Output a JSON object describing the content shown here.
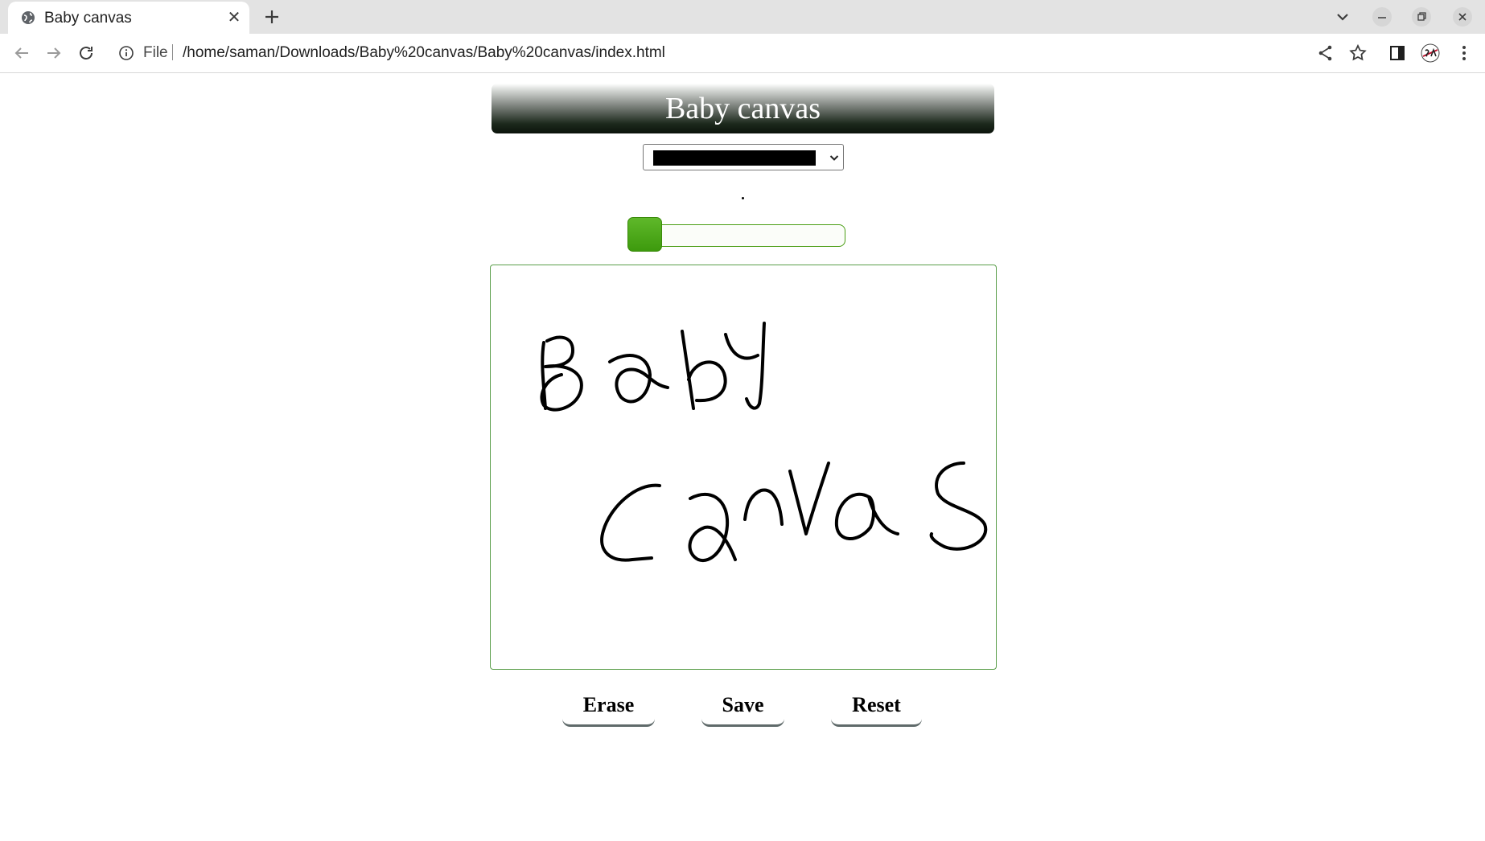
{
  "browser": {
    "tab_title": "Baby canvas",
    "omnibox_scheme_label": "File",
    "omnibox_url": "/home/saman/Downloads/Baby%20canvas/Baby%20canvas/index.html"
  },
  "page": {
    "title": "Baby canvas",
    "color_select": {
      "selected_color": "#000000"
    },
    "brush_size_slider": {
      "value_fraction": 0.0
    },
    "canvas": {
      "ink_color": "#000000",
      "border_color": "#5a9e4a"
    },
    "buttons": {
      "erase_label": "Erase",
      "save_label": "Save",
      "reset_label": "Reset"
    }
  },
  "colors": {
    "slider_accent": "#4a9e14",
    "button_shadow": "#5f6a6a",
    "tabbar_background": "#e3e3e3"
  }
}
